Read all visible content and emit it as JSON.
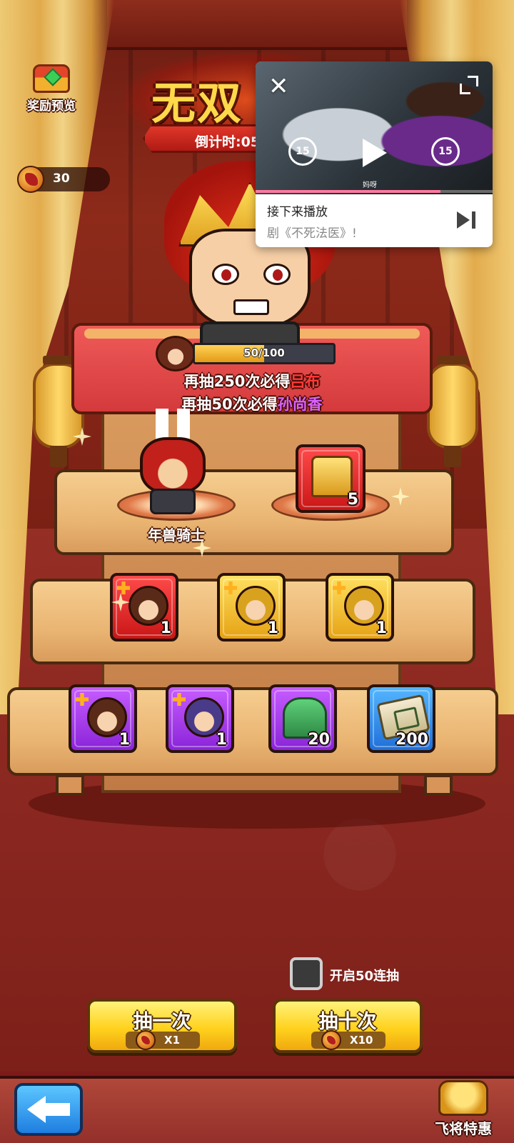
{
  "top_left": {
    "reward_preview_label": "奖励预览",
    "reward_icon": "treasure-chest-icon"
  },
  "currency": {
    "icon": "dragon-token-icon",
    "value": "30"
  },
  "event": {
    "title": "无双",
    "countdown": "倒计时:05"
  },
  "progress": {
    "current": 50,
    "max": 100,
    "fraction": 0.5,
    "text": "50/100"
  },
  "pity": {
    "line1_prefix": "再抽250次必得",
    "line1_hero": "吕布",
    "line2_prefix": "再抽50次必得",
    "line2_hero": "孙尚香"
  },
  "featured": {
    "hero_name": "年兽骑士",
    "treasure_count": "5"
  },
  "shelf2": [
    {
      "type": "hero-fragment",
      "color": "#d81f1f",
      "count": "1"
    },
    {
      "type": "hero-fragment",
      "color": "#f0b31c",
      "count": "1"
    },
    {
      "type": "hero-fragment",
      "color": "#f0b31c",
      "count": "1"
    }
  ],
  "shelf3": [
    {
      "type": "hero-fragment",
      "color": "#9a2fe0",
      "count": "1"
    },
    {
      "type": "hero-fragment",
      "color": "#9a2fe0",
      "count": "1"
    },
    {
      "type": "jade-seal",
      "color": "#9a2fe0",
      "count": "20"
    },
    {
      "type": "scroll",
      "color": "#2a86e8",
      "count": "200"
    }
  ],
  "video": {
    "caption": "妈呀",
    "skip_back_label": "15",
    "skip_forward_label": "15",
    "progress_fraction": 0.78,
    "up_next_label": "接下来播放",
    "up_next_title": "剧《不死法医》!"
  },
  "controls": {
    "batch_label": "开启50连抽",
    "draw_one_label": "抽一次",
    "draw_one_cost": "X1",
    "draw_ten_label": "抽十次",
    "draw_ten_cost": "X10"
  },
  "bottom": {
    "deal_label": "飞将特惠"
  },
  "colors": {
    "accent_red": "#ff3b3b",
    "accent_purple": "#d763ff",
    "button_gold": "#ffd21e",
    "back_blue": "#2a8ae8"
  }
}
